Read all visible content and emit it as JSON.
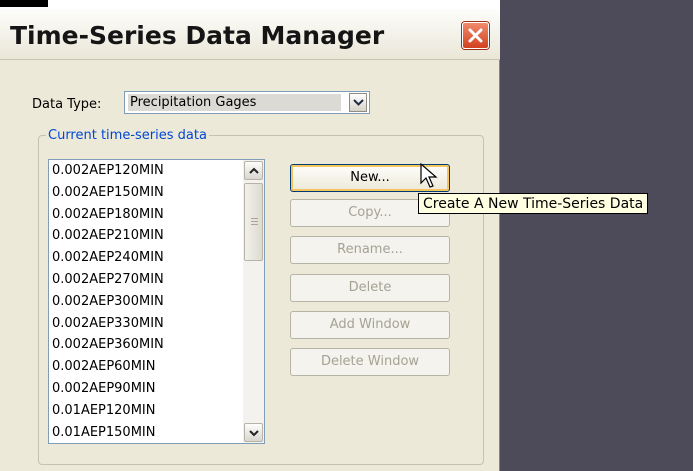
{
  "window": {
    "title": "Time-Series Data Manager"
  },
  "data_type": {
    "label": "Data Type:",
    "selected": "Precipitation Gages"
  },
  "group": {
    "label": "Current time-series data",
    "items": [
      "0.002AEP120MIN",
      "0.002AEP150MIN",
      "0.002AEP180MIN",
      "0.002AEP210MIN",
      "0.002AEP240MIN",
      "0.002AEP270MIN",
      "0.002AEP300MIN",
      "0.002AEP330MIN",
      "0.002AEP360MIN",
      "0.002AEP60MIN",
      "0.002AEP90MIN",
      "0.01AEP120MIN",
      "0.01AEP150MIN"
    ]
  },
  "buttons": {
    "new": "New...",
    "copy": "Copy...",
    "rename": "Rename...",
    "delete": "Delete",
    "add_window": "Add Window",
    "delete_window": "Delete Window"
  },
  "tooltip": "Create A New Time-Series Data",
  "icons": {
    "close": "close-icon",
    "dropdown": "chevron-down-icon",
    "scroll_up": "chevron-up-icon",
    "scroll_down": "chevron-down-icon",
    "cursor": "mouse-pointer-icon"
  }
}
